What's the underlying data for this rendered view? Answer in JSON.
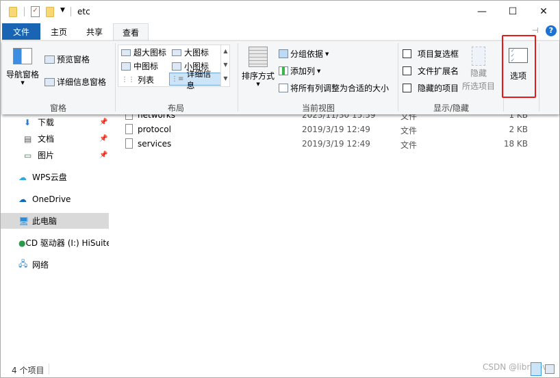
{
  "window": {
    "title": "etc",
    "minimize": "—",
    "maximize": "☐",
    "close": "✕"
  },
  "tabs": [
    {
      "label": "文件"
    },
    {
      "label": "主页"
    },
    {
      "label": "共享"
    },
    {
      "label": "查看"
    }
  ],
  "ribbon": {
    "panes": {
      "nav_pane": "导航窗格",
      "preview_pane": "预览窗格",
      "details_pane": "详细信息窗格",
      "group": "窗格"
    },
    "layout": {
      "items": [
        "超大图标",
        "大图标",
        "中图标",
        "小图标",
        "列表",
        "详细信息"
      ],
      "selected": "详细信息",
      "group": "布局"
    },
    "current_view": {
      "sort_by": "排序方式",
      "group_by": "分组依据",
      "add_column": "添加列",
      "size_all": "将所有列调整为合适的大小",
      "group": "当前视图"
    },
    "show_hide": {
      "checkboxes": [
        {
          "label": "项目复选框",
          "checked": false
        },
        {
          "label": "文件扩展名",
          "checked": false
        },
        {
          "label": "隐藏的项目",
          "checked": false
        }
      ],
      "hide_selected_1": "隐藏",
      "hide_selected_2": "所选项目",
      "group": "显示/隐藏"
    },
    "options": {
      "label": "选项",
      "highlight_color": "#e81818"
    }
  },
  "sidebar": {
    "items": [
      {
        "label": "下载",
        "pinned": true
      },
      {
        "label": "文档",
        "pinned": true
      },
      {
        "label": "图片",
        "pinned": true
      },
      {
        "label": "WPS云盘"
      },
      {
        "label": "OneDrive"
      },
      {
        "label": "此电脑",
        "selected": true
      },
      {
        "label": "CD 驱动器 (I:) HiSuite"
      },
      {
        "label": "网络"
      }
    ]
  },
  "files": [
    {
      "name": "networks",
      "date": "2023/11/30 15:59",
      "type": "文件",
      "size": "1 KB"
    },
    {
      "name": "protocol",
      "date": "2019/3/19 12:49",
      "type": "文件",
      "size": "2 KB"
    },
    {
      "name": "services",
      "date": "2019/3/19 12:49",
      "type": "文件",
      "size": "18 KB"
    }
  ],
  "status": {
    "count": "4 个项目"
  },
  "watermark": "CSDN @libralove",
  "colors": {
    "file_tab": "#1a64b4",
    "selection": "#cce4f7"
  }
}
